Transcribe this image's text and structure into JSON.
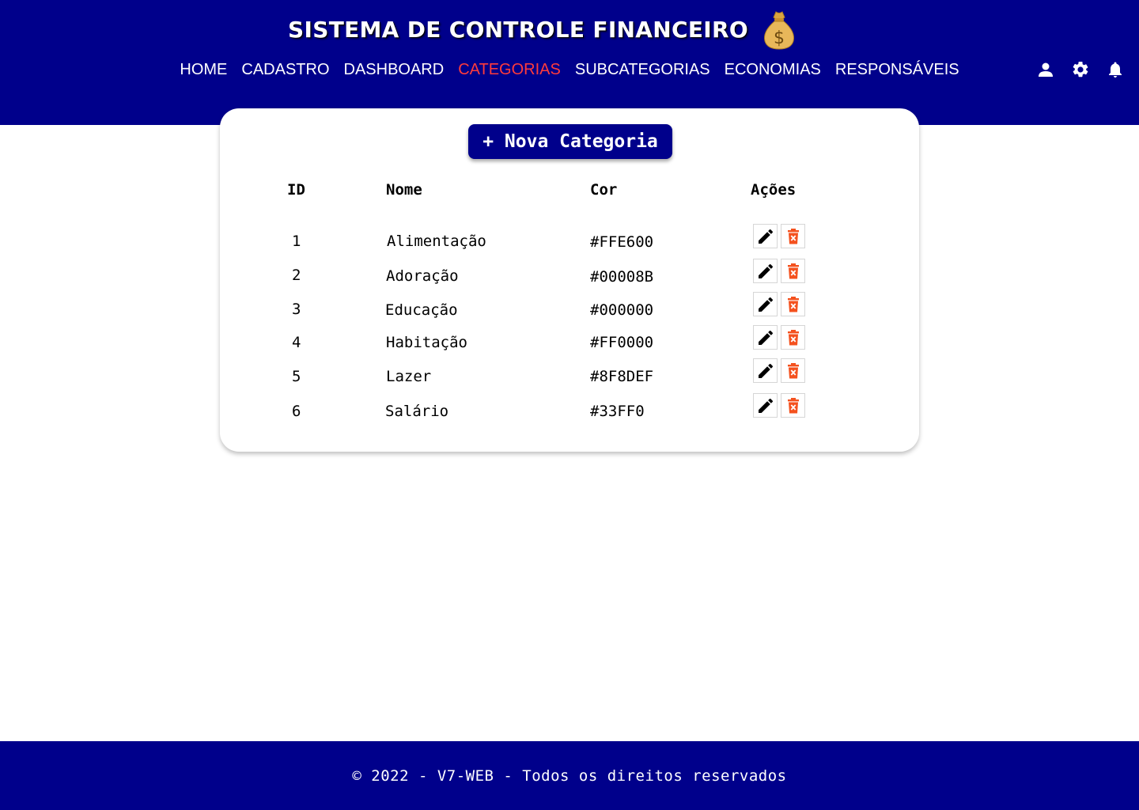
{
  "header": {
    "title": "SISTEMA DE CONTROLE FINANCEIRO",
    "logo_icon": "money-bag-icon",
    "nav": [
      {
        "label": "HOME",
        "active": false
      },
      {
        "label": "CADASTRO",
        "active": false
      },
      {
        "label": "DASHBOARD",
        "active": false
      },
      {
        "label": "CATEGORIAS",
        "active": true
      },
      {
        "label": "SUBCATEGORIAS",
        "active": false
      },
      {
        "label": "ECONOMIAS",
        "active": false
      },
      {
        "label": "RESPONSÁVEIS",
        "active": false
      }
    ],
    "icons": [
      "user-icon",
      "gear-icon",
      "bell-icon"
    ]
  },
  "main": {
    "new_button_label": "+ Nova Categoria",
    "table": {
      "headers": {
        "id": "ID",
        "nome": "Nome",
        "cor": "Cor",
        "acoes": "Ações"
      },
      "rows": [
        {
          "id": "1",
          "nome": "Alimentação",
          "cor": "#FFE600"
        },
        {
          "id": "2",
          "nome": "Adoração",
          "cor": "#00008B"
        },
        {
          "id": "3",
          "nome": "Educação",
          "cor": "#000000"
        },
        {
          "id": "4",
          "nome": "Habitação",
          "cor": "#FF0000"
        },
        {
          "id": "5",
          "nome": "Lazer",
          "cor": "#8F8DEF"
        },
        {
          "id": "6",
          "nome": "Salário",
          "cor": "#33FF0"
        }
      ],
      "row_actions": [
        "edit-pencil-icon",
        "delete-trash-icon"
      ]
    }
  },
  "footer": {
    "text": "© 2022 - V7-WEB - Todos os direitos reservados"
  },
  "colors": {
    "primary": "#00008B",
    "active_nav": "#FF3B3B",
    "delete": "#F4511E"
  }
}
